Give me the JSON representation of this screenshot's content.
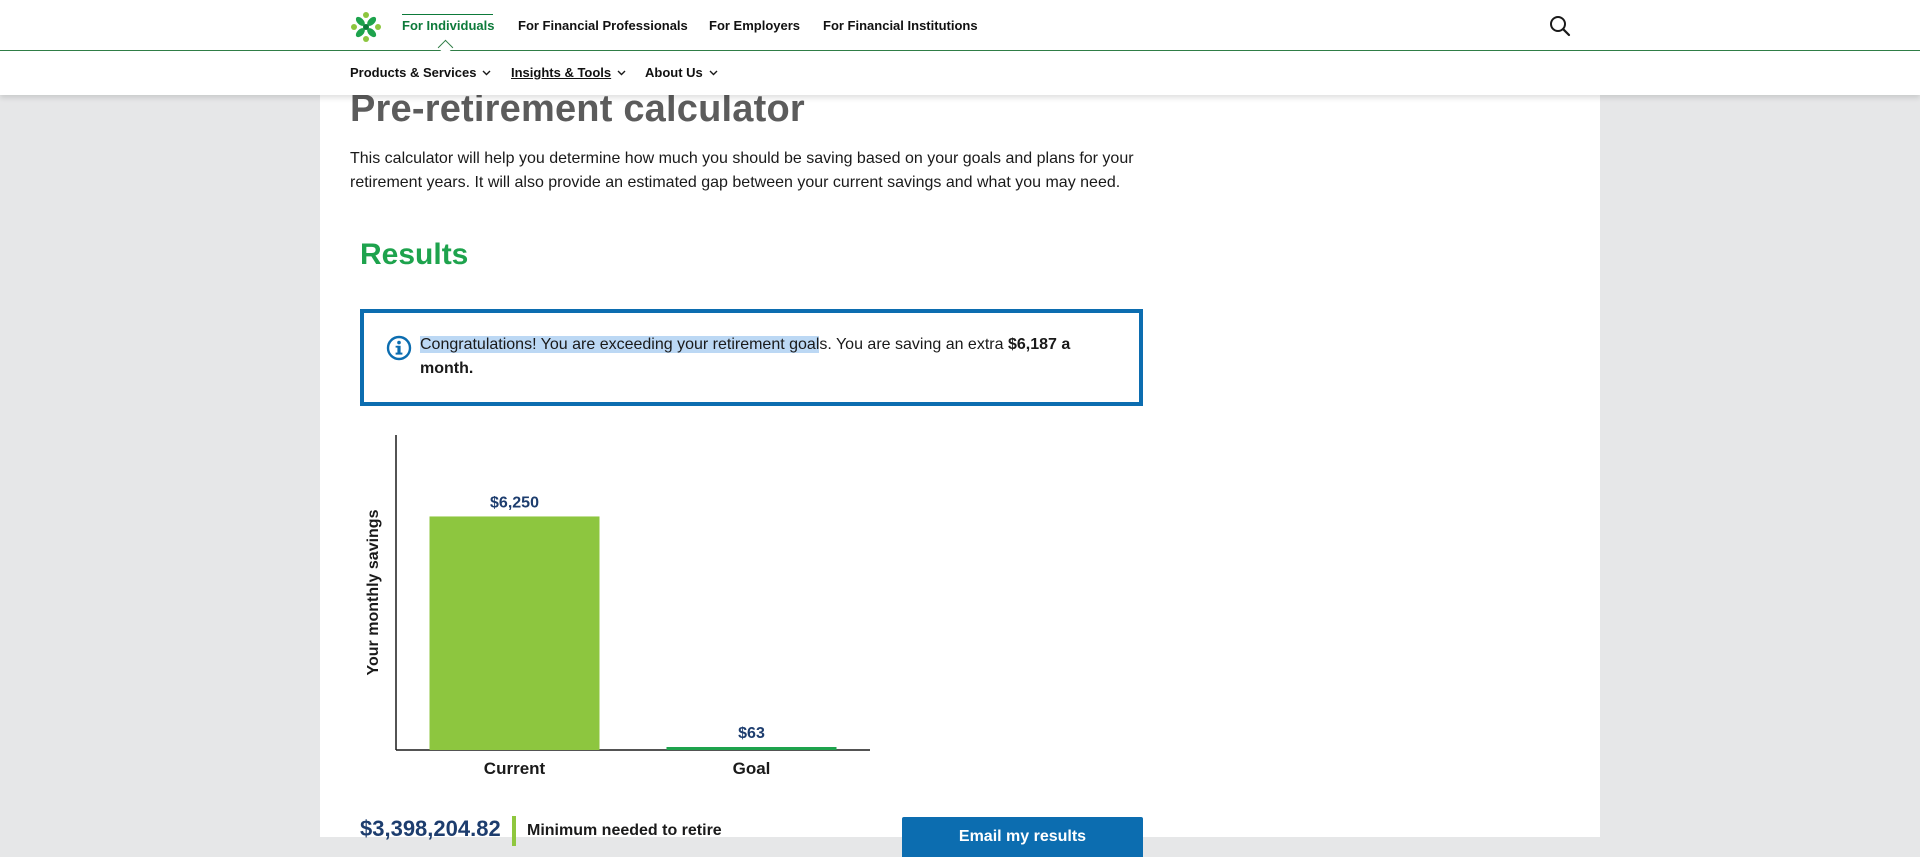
{
  "nav": {
    "top": [
      "For Individuals",
      "For Financial Professionals",
      "For Employers",
      "For Financial Institutions"
    ],
    "sub": [
      "Products & Services",
      "Insights & Tools",
      "About Us"
    ]
  },
  "page": {
    "title": "Pre-retirement calculator",
    "intro": "This calculator will help you determine how much you should be saving based on your goals and plans for your retirement years. It will also provide an estimated gap between your current savings and what you may need.",
    "results_heading": "Results"
  },
  "alert": {
    "highlighted": "Congratulations! You are exceeding your retirement goal",
    "rest": "s. You are saving an extra ",
    "amount": "$6,187 a month."
  },
  "chart_data": {
    "type": "bar",
    "categories": [
      "Current",
      "Goal"
    ],
    "values": [
      6250,
      63
    ],
    "value_labels": [
      "$6,250",
      "$63"
    ],
    "ylabel": "Your monthly savings",
    "ylim": [
      0,
      8430
    ],
    "colors": [
      "#8dc63f",
      "#1ea34d"
    ],
    "value_label_color": "#1d3d6e"
  },
  "summary": {
    "value": "$3,398,204.82",
    "label": "Minimum needed to retire"
  },
  "actions": {
    "email": "Email my results"
  },
  "colors": {
    "brand_green": "#1ea34d",
    "brand_blue": "#0c6db0",
    "accent_lime": "#8dc63f"
  }
}
